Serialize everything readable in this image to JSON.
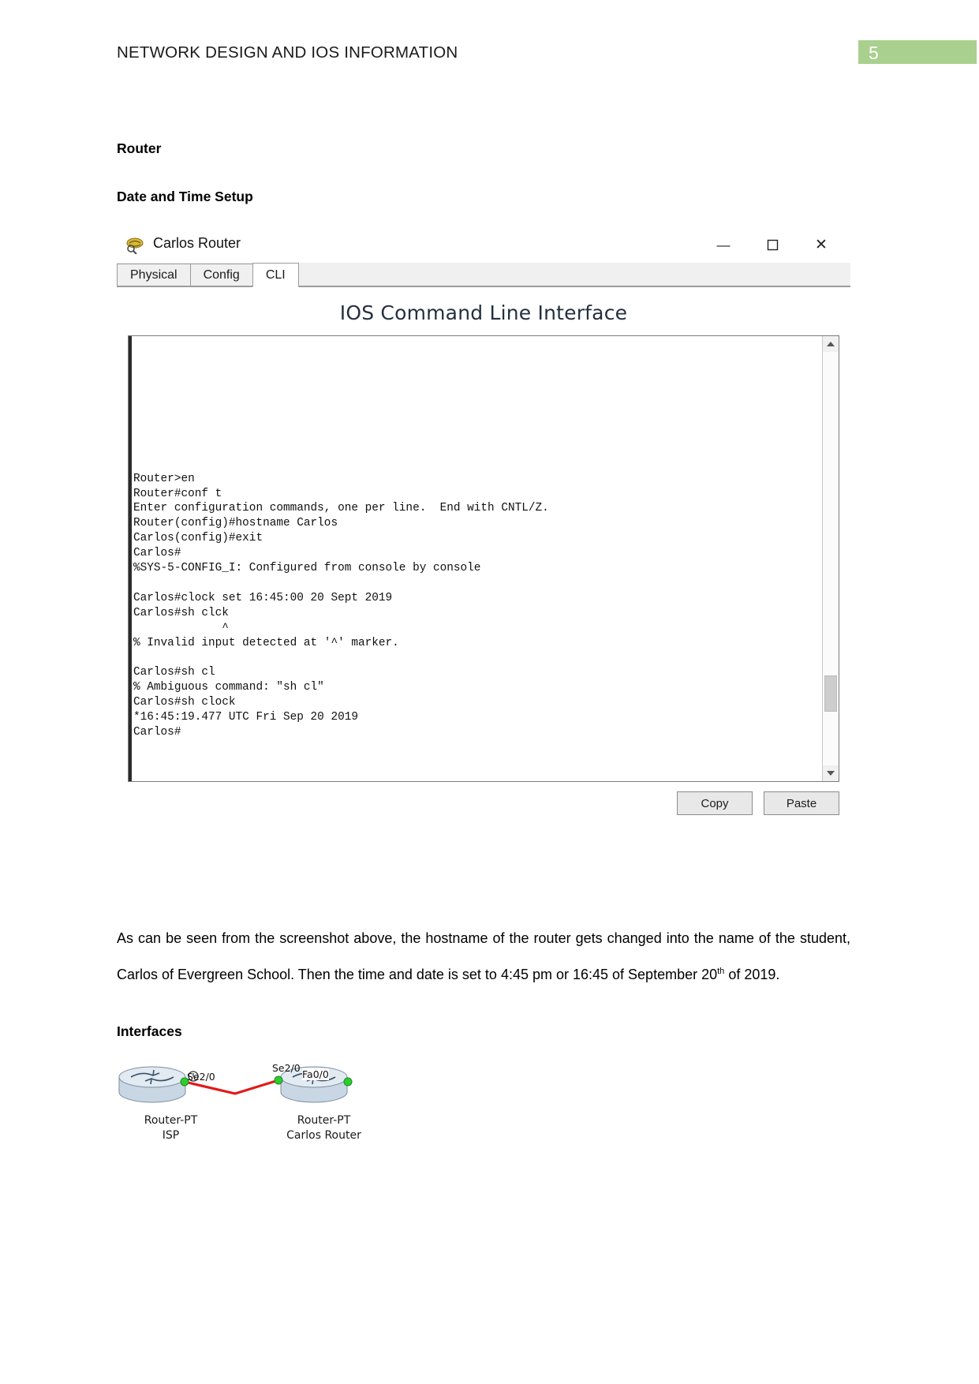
{
  "header": {
    "title": "NETWORK DESIGN AND IOS INFORMATION",
    "page_number": "5",
    "badge_color": "#a9d08e"
  },
  "headings": {
    "router": "Router",
    "date_time_setup": "Date and Time Setup",
    "interfaces": "Interfaces"
  },
  "packet_tracer_window": {
    "title": "Carlos Router",
    "icon": "router-device-icon",
    "window_controls": {
      "minimize": "—",
      "maximize": "□",
      "close": "✕"
    },
    "tabs": [
      {
        "label": "Physical",
        "active": false
      },
      {
        "label": "Config",
        "active": false
      },
      {
        "label": "CLI",
        "active": true
      }
    ],
    "cli_panel_title": "IOS Command Line Interface",
    "cli_output": "\n\n\n\n\n\n\n\nRouter>en\nRouter#conf t\nEnter configuration commands, one per line.  End with CNTL/Z.\nRouter(config)#hostname Carlos\nCarlos(config)#exit\nCarlos#\n%SYS-5-CONFIG_I: Configured from console by console\n\nCarlos#clock set 16:45:00 20 Sept 2019\nCarlos#sh clck\n             ^\n% Invalid input detected at '^' marker.\n\nCarlos#sh cl\n% Ambiguous command: \"sh cl\"\nCarlos#sh clock\n*16:45:19.477 UTC Fri Sep 20 2019\nCarlos#",
    "buttons": {
      "copy": "Copy",
      "paste": "Paste"
    }
  },
  "paragraph": {
    "part1": "As can be seen from the screenshot above, the hostname of the router gets changed into the name of the student, Carlos of Evergreen School. Then the time and date is set to 4:45 pm or 16:45 of September 20",
    "ordinal": "th",
    "part2": " of 2019."
  },
  "topology": {
    "devices": [
      {
        "name": "Router-PT",
        "sub": "ISP"
      },
      {
        "name": "Router-PT",
        "sub": "Carlos Router"
      }
    ],
    "interface_labels": [
      "Se2/0",
      "Se2/0",
      "Fa0/0"
    ],
    "link_color": "#e01b1b"
  }
}
